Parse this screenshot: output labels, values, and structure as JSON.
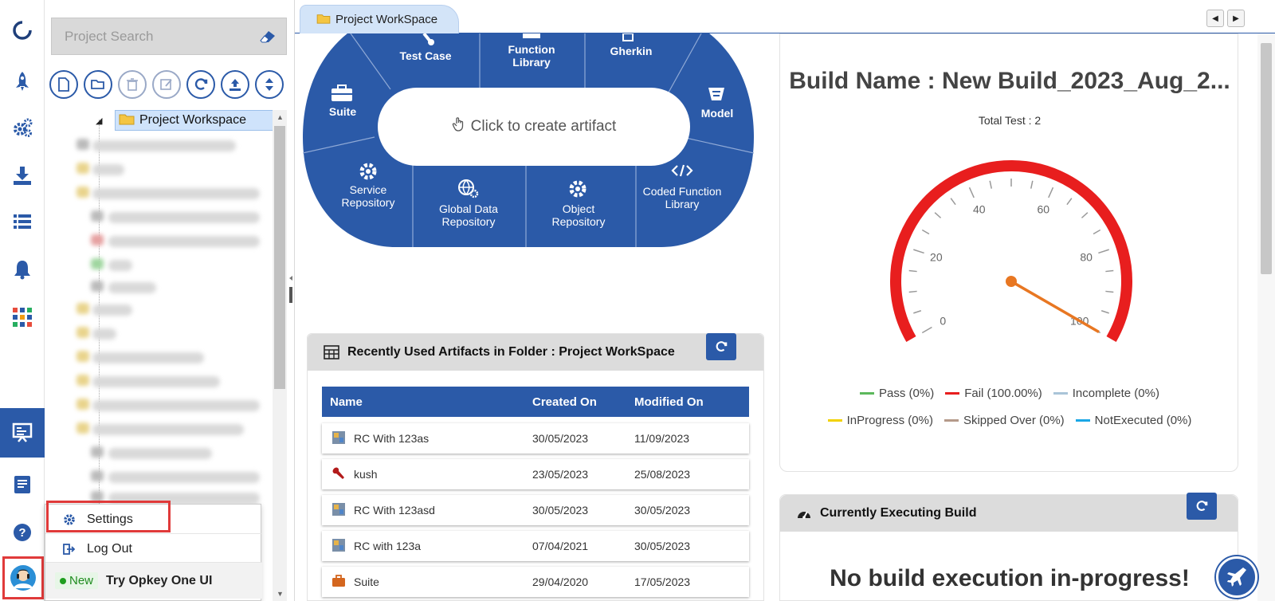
{
  "app": {
    "brand_icon": "opkey-logo-icon",
    "accent": "#2b5aa8",
    "highlight": "#e03a3a"
  },
  "rail": {
    "icons": [
      "opkey-logo-icon",
      "rocket-icon",
      "gears-icon",
      "download-icon",
      "list-icon",
      "bell-icon",
      "apps-grid-icon",
      "dashboard-board-icon",
      "book-icon",
      "help-icon",
      "user-avatar-icon"
    ]
  },
  "tree": {
    "search_placeholder": "Project Search",
    "root_label": "Project Workspace",
    "tools": [
      "new-file-icon",
      "open-folder-icon",
      "delete-icon",
      "edit-icon",
      "refresh-icon",
      "upload-icon",
      "sort-icon"
    ]
  },
  "user_menu": {
    "settings": "Settings",
    "logout": "Log Out",
    "new_badge": "New",
    "try_ui": "Try Opkey One UI"
  },
  "tabs": [
    {
      "label": "Project WorkSpace"
    }
  ],
  "wheel": {
    "test_case": "Test Case",
    "function_library_1": "Function",
    "function_library_2": "Library",
    "gherkin": "Gherkin",
    "suite": "Suite",
    "model": "Model",
    "service_repo_1": "Service",
    "service_repo_2": "Repository",
    "global_data_1": "Global Data",
    "global_data_2": "Repository",
    "object_repo_1": "Object",
    "object_repo_2": "Repository",
    "coded_fn_1": "Coded Function",
    "coded_fn_2": "Library",
    "create": "Click to create artifact"
  },
  "recent": {
    "title": "Recently Used Artifacts in Folder : Project WorkSpace",
    "columns": {
      "name": "Name",
      "created": "Created On",
      "modified": "Modified On"
    },
    "rows": [
      {
        "name": "RC With 123as",
        "created": "30/05/2023",
        "modified": "11/09/2023",
        "icon": "recovery-icon"
      },
      {
        "name": "kush",
        "created": "23/05/2023",
        "modified": "25/08/2023",
        "icon": "wrench-icon"
      },
      {
        "name": "RC With 123asd",
        "created": "30/05/2023",
        "modified": "30/05/2023",
        "icon": "recovery-icon"
      },
      {
        "name": "RC with 123a",
        "created": "07/04/2021",
        "modified": "30/05/2023",
        "icon": "recovery-icon"
      },
      {
        "name": "Suite",
        "created": "29/04/2020",
        "modified": "17/05/2023",
        "icon": "suitcase-icon"
      }
    ]
  },
  "build": {
    "title": "Build Name : New Build_2023_Aug_2...",
    "total": "Total Test : 2",
    "gauge_value": 100,
    "gauge_ticks": [
      "0",
      "20",
      "40",
      "60",
      "80",
      "100"
    ],
    "legend": [
      {
        "label": "Pass (0%)",
        "color": "#5cb85c"
      },
      {
        "label": "Fail (100.00%)",
        "color": "#e81e1e"
      },
      {
        "label": "Incomplete (0%)",
        "color": "#a9c4d8"
      },
      {
        "label": "InProgress (0%)",
        "color": "#f2d200"
      },
      {
        "label": "Skipped Over (0%)",
        "color": "#b59a8a"
      },
      {
        "label": "NotExecuted (0%)",
        "color": "#1aa7e6"
      }
    ]
  },
  "executing": {
    "title": "Currently Executing Build",
    "empty": "No build execution in-progress!"
  }
}
